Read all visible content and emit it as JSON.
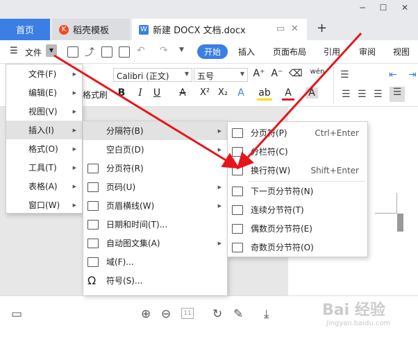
{
  "window": {
    "minimize": "−",
    "maximize": "☐",
    "close": "✕"
  },
  "tabs": {
    "home": "首页",
    "template": "稻壳模板",
    "template_logo": "K",
    "doc": "新建 DOCX 文档.docx",
    "doc_logo": "W",
    "new_tab": "+"
  },
  "menubar": {
    "file": "文件",
    "ribbon_tabs": [
      "开始",
      "插入",
      "页面布局",
      "引用",
      "审阅",
      "视图"
    ]
  },
  "ribbon": {
    "font_name": "Calibri (正文)",
    "font_size": "五号",
    "format_painter_suffix": "格式刷",
    "buttons": {
      "bold": "B",
      "italic": "I",
      "underline": "U",
      "strikethrough": "A",
      "superscript": "X²",
      "subscript": "X₂",
      "text_effect": "A",
      "highlight": "ab",
      "font_color": "A",
      "char_shade": "A",
      "grow": "A⁺",
      "shrink": "A⁻",
      "clear": "⌫",
      "phonetic": "wén"
    }
  },
  "file_menu": {
    "items": [
      {
        "label": "文件(F)",
        "has_sub": true
      },
      {
        "label": "编辑(E)",
        "has_sub": true
      },
      {
        "label": "视图(V)",
        "has_sub": true
      },
      {
        "label": "插入(I)",
        "has_sub": true,
        "highlighted": true
      },
      {
        "label": "格式(O)",
        "has_sub": true
      },
      {
        "label": "工具(T)",
        "has_sub": true
      },
      {
        "label": "表格(A)",
        "has_sub": true
      },
      {
        "label": "窗口(W)",
        "has_sub": true
      }
    ]
  },
  "insert_menu": {
    "items": [
      {
        "label": "分隔符(B)",
        "has_sub": true,
        "highlighted": true
      },
      {
        "label": "空白页(D)",
        "has_sub": true
      },
      {
        "label": "分页符(R)",
        "has_sub": false
      },
      {
        "label": "页码(U)",
        "has_sub": true
      },
      {
        "label": "页眉横线(W)",
        "has_sub": true
      },
      {
        "label": "日期和时间(T)...",
        "has_sub": false
      },
      {
        "label": "自动图文集(A)",
        "has_sub": true
      },
      {
        "label": "域(F)...",
        "has_sub": false
      },
      {
        "label": "符号(S)...",
        "has_sub": false
      }
    ]
  },
  "break_menu": {
    "items": [
      {
        "label": "分页符(P)",
        "shortcut": "Ctrl+Enter"
      },
      {
        "label": "分栏符(C)",
        "shortcut": ""
      },
      {
        "label": "换行符(W)",
        "shortcut": "Shift+Enter"
      },
      {
        "label": "下一页分节符(N)",
        "shortcut": ""
      },
      {
        "label": "连续分节符(T)",
        "shortcut": ""
      },
      {
        "label": "偶数页分节符(E)",
        "shortcut": ""
      },
      {
        "label": "奇数页分节符(O)",
        "shortcut": ""
      }
    ]
  },
  "statusbar": {
    "page_num": "11"
  },
  "watermark": {
    "brand": "Bai 经验",
    "url": "jingyan.baidu.com"
  },
  "colors": {
    "accent": "#3b7ee6",
    "arrow": "#e8141b",
    "highlight": "#e2e2e2"
  }
}
